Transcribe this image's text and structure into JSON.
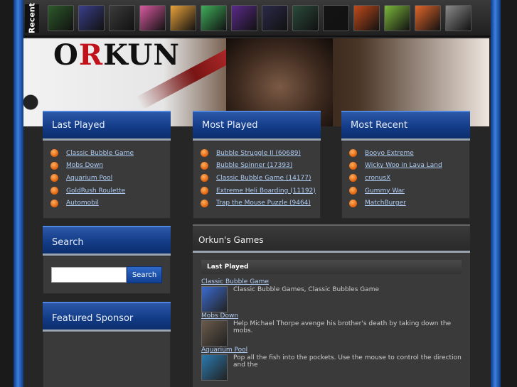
{
  "recent": {
    "label": "Recent",
    "thumbs": [
      {
        "name": "recent-game-1-icon",
        "color": "#2d5a2a"
      },
      {
        "name": "recent-game-2-icon",
        "color": "#3a3f8a"
      },
      {
        "name": "recent-game-3-icon",
        "color": "#3b3b3b"
      },
      {
        "name": "recent-game-4-icon",
        "color": "#d85aa0"
      },
      {
        "name": "recent-game-5-icon",
        "color": "#e8a23a"
      },
      {
        "name": "recent-game-6-icon",
        "color": "#3fae5a"
      },
      {
        "name": "recent-game-7-icon",
        "color": "#5b2a8a"
      },
      {
        "name": "recent-game-8-icon",
        "color": "#2a2a4a"
      },
      {
        "name": "recent-game-9-icon",
        "color": "#2a4a3a"
      },
      {
        "name": "recent-game-10-icon",
        "color": "#141414"
      },
      {
        "name": "recent-game-11-icon",
        "color": "#c04a1a"
      },
      {
        "name": "recent-game-12-icon",
        "color": "#7cb83a"
      },
      {
        "name": "recent-game-13-icon",
        "color": "#e0662a"
      },
      {
        "name": "recent-game-14-icon",
        "color": "#8a8a8a"
      }
    ]
  },
  "banner": {
    "title_pre": "O",
    "title_r": "R",
    "title_post": "KUN"
  },
  "last_played": {
    "title": "Last Played",
    "items": [
      "Classic Bubble Game",
      "Mobs Down",
      "Aquarium Pool",
      "GoldRush Roulette",
      "Automobil"
    ]
  },
  "most_played": {
    "title": "Most Played",
    "items": [
      "Bubble Struggle II (60689)",
      "Bubble Spinner (17393)",
      "Classic Bubble Game (14177)",
      "Extreme Heli Boarding (11192)",
      "Trap the Mouse Puzzle (9464)"
    ]
  },
  "most_recent": {
    "title": "Most Recent",
    "items": [
      "Booyo Extreme",
      "Wicky Woo in Lava Land",
      "cronusX",
      "Gummy War",
      "MatchBurger"
    ]
  },
  "search": {
    "title": "Search",
    "button": "Search",
    "placeholder": ""
  },
  "sponsor": {
    "title": "Featured Sponsor"
  },
  "games": {
    "title": "Orkun's Games",
    "section": "Last Played",
    "entries": [
      {
        "name": "Classic Bubble Game",
        "desc": "Classic Bubble Games, Classic Bubbles Game",
        "color": "#3a6ad0"
      },
      {
        "name": "Mobs Down",
        "desc": "Help Michael Thorpe avenge his brother's death by taking down the mobs.",
        "color": "#6a5a4a"
      },
      {
        "name": "Aquarium Pool",
        "desc": "Pop all the fish into the pockets. Use the mouse to control the direction and the",
        "color": "#2a7ab0"
      }
    ]
  }
}
